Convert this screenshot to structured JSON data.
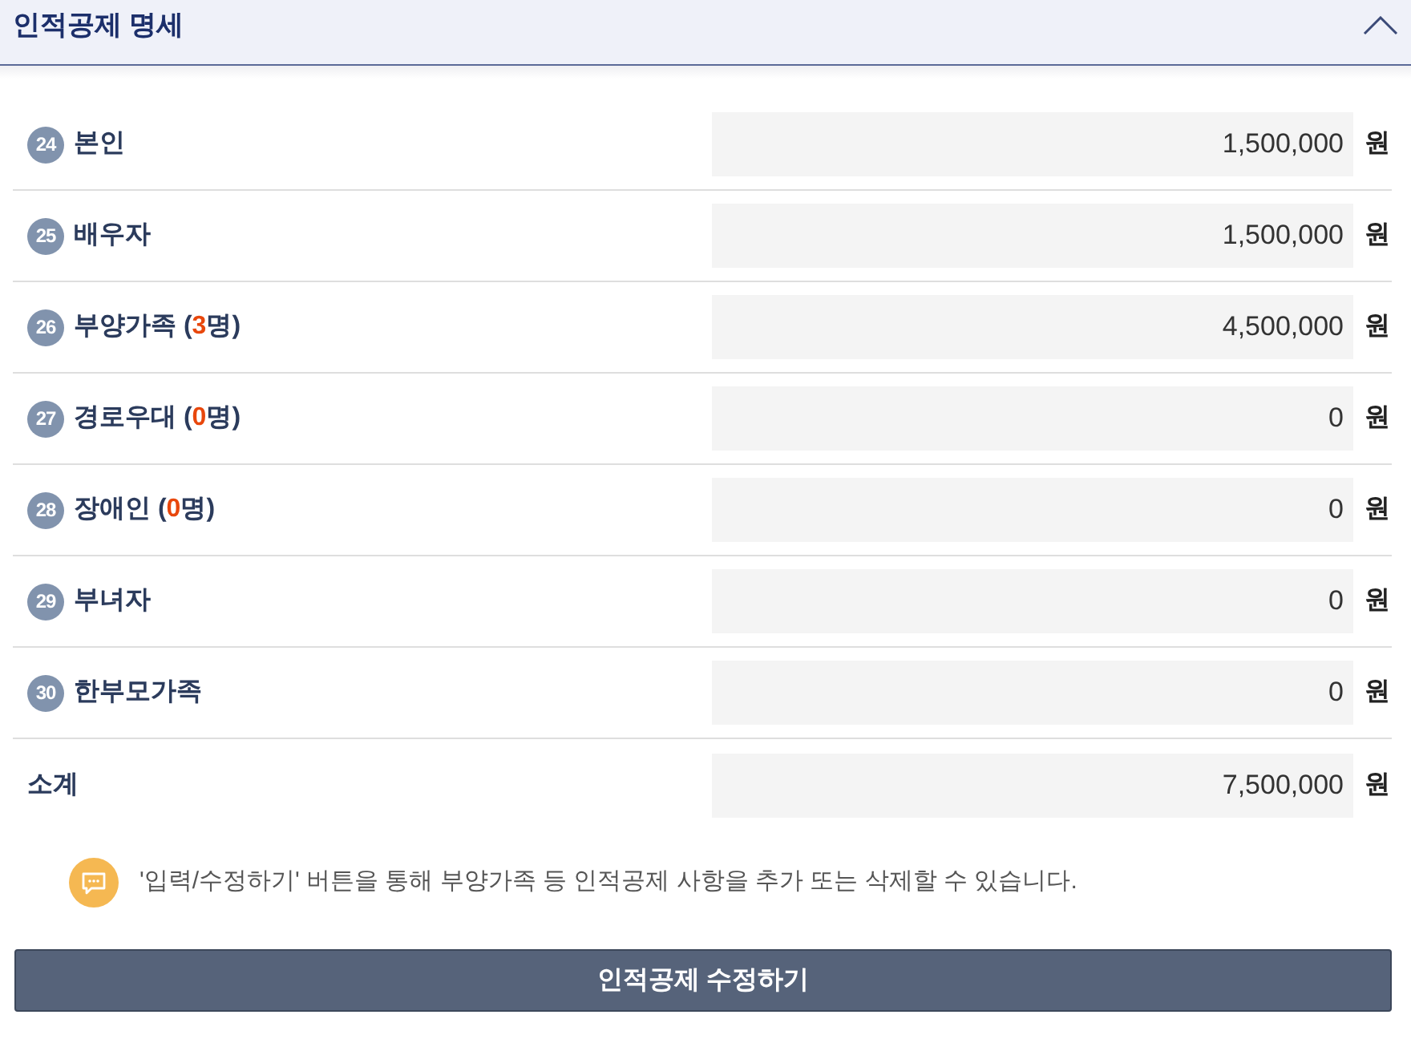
{
  "section": {
    "title": "인적공제 명세",
    "expanded": true
  },
  "rows": [
    {
      "number": "24",
      "label_parts": [
        {
          "kind": "text",
          "text": "본인"
        }
      ],
      "value": "1,500,000",
      "unit": "원"
    },
    {
      "number": "25",
      "label_parts": [
        {
          "kind": "text",
          "text": "배우자"
        }
      ],
      "value": "1,500,000",
      "unit": "원"
    },
    {
      "number": "26",
      "label_parts": [
        {
          "kind": "text",
          "text": "부양가족 ("
        },
        {
          "kind": "count",
          "text": "3"
        },
        {
          "kind": "text",
          "text": "명)"
        }
      ],
      "value": "4,500,000",
      "unit": "원"
    },
    {
      "number": "27",
      "label_parts": [
        {
          "kind": "text",
          "text": "경로우대 ("
        },
        {
          "kind": "count",
          "text": "0"
        },
        {
          "kind": "text",
          "text": "명)"
        }
      ],
      "value": "0",
      "unit": "원"
    },
    {
      "number": "28",
      "label_parts": [
        {
          "kind": "text",
          "text": "장애인 ("
        },
        {
          "kind": "count",
          "text": "0"
        },
        {
          "kind": "text",
          "text": "명)"
        }
      ],
      "value": "0",
      "unit": "원"
    },
    {
      "number": "29",
      "label_parts": [
        {
          "kind": "text",
          "text": "부녀자"
        }
      ],
      "value": "0",
      "unit": "원"
    },
    {
      "number": "30",
      "label_parts": [
        {
          "kind": "text",
          "text": "한부모가족"
        }
      ],
      "value": "0",
      "unit": "원"
    }
  ],
  "subtotal": {
    "label": "소계",
    "value": "7,500,000",
    "unit": "원"
  },
  "note": {
    "text": "'입력/수정하기' 버튼을 통해 부양가족 등 인적공제 사항을 추가 또는 삭제할 수 있습니다."
  },
  "button": {
    "label": "인적공제 수정하기"
  }
}
